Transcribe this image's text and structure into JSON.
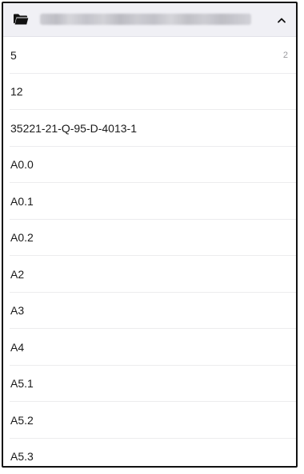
{
  "header": {
    "icon": "folder-icon",
    "title_obscured": true,
    "toggle_icon": "chevron-up-icon"
  },
  "list": {
    "items": [
      {
        "label": "5",
        "count": "2"
      },
      {
        "label": "12",
        "count": ""
      },
      {
        "label": "35221-21-Q-95-D-4013-1",
        "count": ""
      },
      {
        "label": "A0.0",
        "count": ""
      },
      {
        "label": "A0.1",
        "count": ""
      },
      {
        "label": "A0.2",
        "count": ""
      },
      {
        "label": "A2",
        "count": ""
      },
      {
        "label": "A3",
        "count": ""
      },
      {
        "label": "A4",
        "count": ""
      },
      {
        "label": "A5.1",
        "count": ""
      },
      {
        "label": "A5.2",
        "count": ""
      },
      {
        "label": "A5.3",
        "count": ""
      }
    ]
  }
}
